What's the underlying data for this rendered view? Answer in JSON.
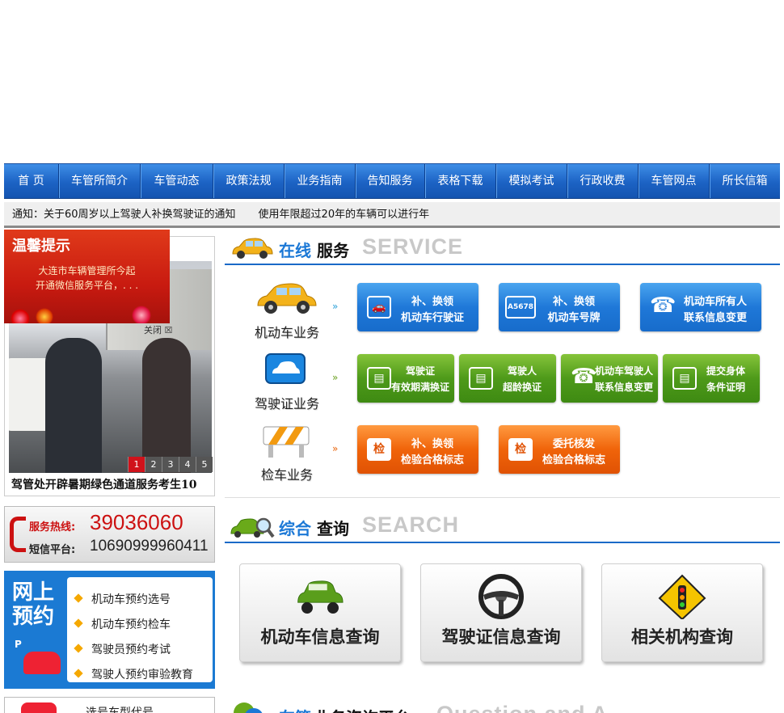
{
  "nav": [
    "首 页",
    "车管所简介",
    "车管动态",
    "政策法规",
    "业务指南",
    "告知服务",
    "表格下载",
    "模拟考试",
    "行政收费",
    "车管网点",
    "所长信箱"
  ],
  "notices": [
    "通知：关于60周岁以上驾驶人补换驾驶证的通知",
    "使用年限超过20年的车辆可以进行年"
  ],
  "popup": {
    "title": "温馨提示",
    "line1": "大连市车辆管理所今起",
    "line2": "开通微信服务平台，. . .",
    "close": "关闭 ☒"
  },
  "slider": {
    "pages": [
      "1",
      "2",
      "3",
      "4",
      "5"
    ],
    "current": "1",
    "caption": "驾管处开辟暑期绿色通道服务考生10"
  },
  "hotline": {
    "service_label": "服务热线:",
    "service_number": "39036060",
    "sms_label": "短信平台:",
    "sms_number": "10690999960411"
  },
  "booking": {
    "title": "网上预约",
    "sign": "P",
    "items": [
      "机动车预约选号",
      "机动车预约检车",
      "驾驶员预约考试",
      "驾驶人预约审验教育"
    ]
  },
  "bottom_left": {
    "label": "选号车型代号"
  },
  "online_service": {
    "title_a": "在线",
    "title_b": "服务",
    "title_en": "SERVICE",
    "categories": [
      {
        "label": "机动车业务",
        "buttons": [
          {
            "l1": "补、换领",
            "l2": "机动车行驶证",
            "icon": "🚗"
          },
          {
            "l1": "补、换领",
            "l2": "机动车号牌",
            "icon": "A5678"
          },
          {
            "l1": "机动车所有人",
            "l2": "联系信息变更",
            "icon": "☎"
          }
        ]
      },
      {
        "label": "驾驶证业务",
        "buttons": [
          {
            "l1": "驾驶证",
            "l2": "有效期满换证",
            "icon": "▤"
          },
          {
            "l1": "驾驶人",
            "l2": "超龄换证",
            "icon": "▤"
          },
          {
            "l1": "机动车驾驶人",
            "l2": "联系信息变更",
            "icon": "☎"
          },
          {
            "l1": "提交身体",
            "l2": "条件证明",
            "icon": "▤"
          }
        ]
      },
      {
        "label": "检车业务",
        "buttons": [
          {
            "l1": "补、换领",
            "l2": "检验合格标志",
            "icon": "检"
          },
          {
            "l1": "委托核发",
            "l2": "检验合格标志",
            "icon": "检"
          }
        ]
      }
    ]
  },
  "query": {
    "title_a": "综合",
    "title_b": "查询",
    "title_en": "SEARCH",
    "boxes": [
      "机动车信息查询",
      "驾驶证信息查询",
      "相关机构查询"
    ]
  },
  "consult": {
    "title_a": "车管",
    "title_b": "业务咨询平台",
    "title_en": "Question and A"
  }
}
